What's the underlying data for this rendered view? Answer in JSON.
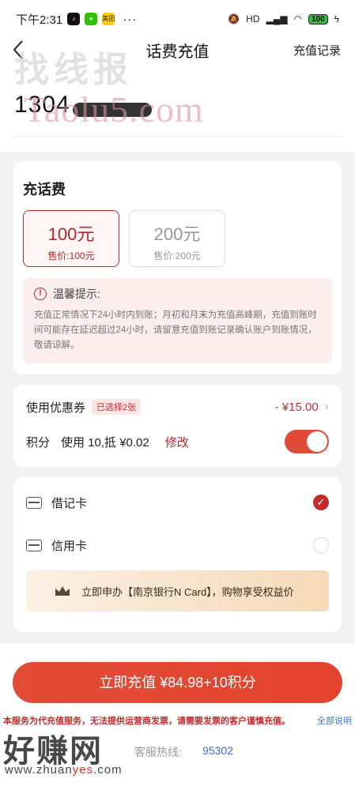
{
  "status_bar": {
    "time": "下午2:31",
    "icons": [
      "tiktok-icon",
      "wechat-icon",
      "meituan-icon"
    ],
    "app3_label": "美团",
    "more": "···",
    "hd": "HD",
    "battery": "100"
  },
  "nav": {
    "title": "话费充值",
    "right_link": "充值记录"
  },
  "watermarks": {
    "top": "找线报",
    "top2": "Taolu5.com",
    "bottom": "好赚网",
    "bottom_url_pre": "www.zhuan",
    "bottom_url_red": "yes",
    "bottom_url_post": ".com"
  },
  "phone": {
    "number_prefix": "1304"
  },
  "topup": {
    "title": "充话费",
    "options": [
      {
        "label": "100元",
        "price": "售价:100元",
        "selected": true
      },
      {
        "label": "200元",
        "price": "售价:200元",
        "selected": false
      }
    ],
    "notice_title": "温馨提示:",
    "notice_body": "充值正常情况下24小时内到账；月初和月末为充值高峰期，充值到账时间可能存在延迟超过24小时，请留意充值到账记录确认账户到账情况，敬请谅解。"
  },
  "coupon": {
    "label": "使用优惠券",
    "tag": "已选择2张",
    "discount": "- ¥15.00",
    "points_label": "积分",
    "points_detail": "使用 10,抵 ¥0.02",
    "modify": "修改",
    "points_enabled": true
  },
  "payment": {
    "methods": [
      {
        "label": "借记卡",
        "selected": true
      },
      {
        "label": "信用卡",
        "selected": false
      }
    ],
    "promo": "立即申办【南京银行N Card】，购物享受权益价"
  },
  "checkout": {
    "button": "立即充值 ¥84.98+10积分",
    "disclaimer": "本服务为代充值服务，无法提供运营商发票，请需要发票的客户谨慎充值。",
    "disclaimer_link": "全部说明",
    "hotline_label": "客服热线:",
    "hotline_number": "95302"
  },
  "colors": {
    "accent": "#c32b2b",
    "cta": "#e24b35",
    "link": "#3d74c8"
  }
}
